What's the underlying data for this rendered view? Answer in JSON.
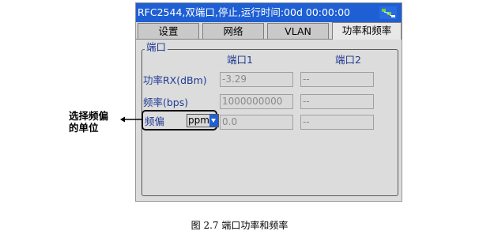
{
  "window": {
    "title": "RFC2544,双端口,停止,运行时间:00d 00:00:00",
    "status_icon": "network-activity-icon",
    "title_bar_color": "#1f5fd4"
  },
  "tabs": [
    {
      "label": "设置",
      "active": false
    },
    {
      "label": "网络",
      "active": false
    },
    {
      "label": "VLAN",
      "active": false
    },
    {
      "label": "功率和频率",
      "active": true
    }
  ],
  "group": {
    "legend": "端口",
    "col_headers": [
      "端口1",
      "端口2"
    ],
    "rows": [
      {
        "label": "功率RX(dBm)",
        "port1": "-3.29",
        "port2": "--"
      },
      {
        "label": "频率(bps)",
        "port1": "1000000000",
        "port2": "--"
      },
      {
        "label": "频偏",
        "unit_selected": "ppm",
        "port1": "0.0",
        "port2": "--"
      }
    ]
  },
  "annotation": {
    "line1": "选择频偏",
    "line2": "的单位"
  },
  "caption": "图 2.7  端口功率和频率"
}
